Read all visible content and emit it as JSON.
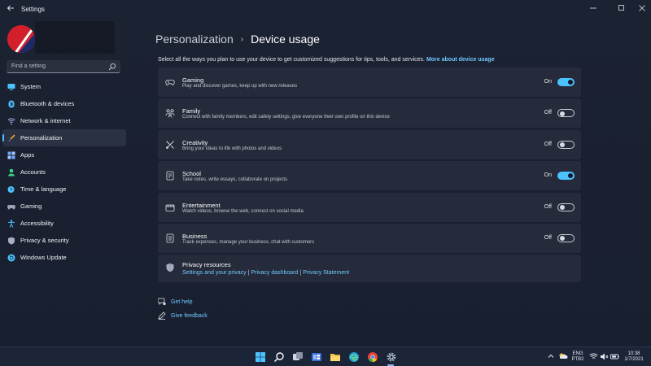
{
  "window": {
    "title": "Settings",
    "controls": [
      "minimize",
      "maximize",
      "close"
    ]
  },
  "sidebar": {
    "search_placeholder": "Find a setting",
    "items": [
      {
        "label": "System",
        "icon": "monitor-icon",
        "color": "#4cc2ff"
      },
      {
        "label": "Bluetooth & devices",
        "icon": "bluetooth-icon",
        "color": "#4cc2ff"
      },
      {
        "label": "Network & internet",
        "icon": "wifi-icon",
        "color": "#9fb7e8"
      },
      {
        "label": "Personalization",
        "icon": "brush-icon",
        "color": "#f0a030",
        "active": true
      },
      {
        "label": "Apps",
        "icon": "apps-icon",
        "color": "#6fa9ff"
      },
      {
        "label": "Accounts",
        "icon": "person-icon",
        "color": "#3fd28a"
      },
      {
        "label": "Time & language",
        "icon": "clock-globe-icon",
        "color": "#4cc2ff"
      },
      {
        "label": "Gaming",
        "icon": "controller-icon",
        "color": "#9aa4b8"
      },
      {
        "label": "Accessibility",
        "icon": "accessibility-icon",
        "color": "#4cc2ff"
      },
      {
        "label": "Privacy & security",
        "icon": "shield-icon",
        "color": "#a8b0c0"
      },
      {
        "label": "Windows Update",
        "icon": "update-icon",
        "color": "#4cc2ff"
      }
    ]
  },
  "main": {
    "breadcrumb_parent": "Personalization",
    "breadcrumb_sep": "›",
    "breadcrumb_current": "Device usage",
    "intro_text": "Select all the ways you plan to use your device to get customized suggestions for tips, tools, and services. ",
    "intro_link": "More about device usage",
    "cards": [
      {
        "title": "Gaming",
        "desc": "Play and discover games, keep up with new releases",
        "state": "On",
        "on": true,
        "icon": "controller-icon"
      },
      {
        "title": "Family",
        "desc": "Connect with family members, edit safety settings, give everyone their own profile on this device",
        "state": "Off",
        "on": false,
        "icon": "family-icon"
      },
      {
        "title": "Creativity",
        "desc": "Bring your ideas to life with photos and videos",
        "state": "Off",
        "on": false,
        "icon": "creativity-icon"
      },
      {
        "title": "School",
        "desc": "Take notes, write essays, collaborate on projects",
        "state": "On",
        "on": true,
        "icon": "school-icon"
      },
      {
        "title": "Entertainment",
        "desc": "Watch videos, browse the web, connect on social media",
        "state": "Off",
        "on": false,
        "icon": "entertainment-icon"
      },
      {
        "title": "Business",
        "desc": "Track expenses, manage your business, chat with customers",
        "state": "Off",
        "on": false,
        "icon": "business-icon"
      }
    ],
    "privacy": {
      "title": "Privacy resources",
      "links": [
        "Settings and your privacy",
        "Privacy dashboard",
        "Privacy Statement"
      ],
      "separator": "|"
    },
    "get_help": "Get help",
    "give_feedback": "Give feedback"
  },
  "taskbar": {
    "icons": [
      "windows-start-icon",
      "search-icon",
      "task-view-icon",
      "widgets-icon",
      "file-explorer-icon",
      "edge-icon",
      "chrome-icon",
      "settings-icon"
    ],
    "lang_top": "ENG",
    "lang_bottom": "PTB2",
    "time": "10:38",
    "date": "1/7/2021"
  },
  "colors": {
    "accent": "#4cc2ff",
    "link": "#70c9ff",
    "card_bg": "#252b3a",
    "window_bg": "#1b2232"
  }
}
